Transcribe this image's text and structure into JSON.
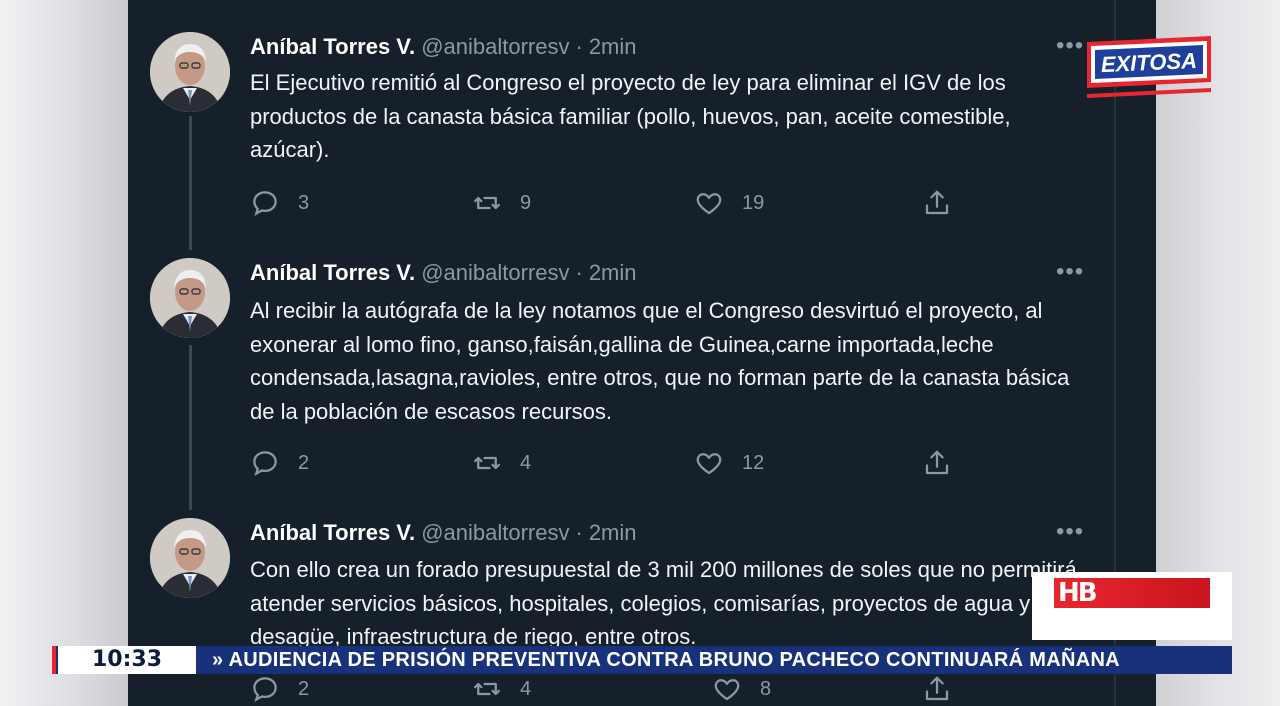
{
  "broadcast": {
    "logo_text": "EXITOSA",
    "badge_text": "HB",
    "ticker": {
      "time": "10:33",
      "headline": "» AUDIENCIA DE PRISIÓN PREVENTIVA CONTRA BRUNO PACHECO CONTINUARÁ MAÑANA"
    }
  },
  "colors": {
    "panel_bg": "#15202b",
    "muted": "#8b98a5",
    "brand_red": "#e8262f",
    "ticker_blue": "#17327a"
  },
  "tweets": [
    {
      "author": "Aníbal Torres V.",
      "handle": "@anibaltorresv",
      "separator": "·",
      "time": "2min",
      "text": "El Ejecutivo remitió al Congreso el proyecto de ley para eliminar el IGV de los productos de la canasta básica familiar (pollo, huevos, pan, aceite comestible, azúcar).",
      "replies": "3",
      "retweets": "9",
      "likes": "19"
    },
    {
      "author": "Aníbal Torres V.",
      "handle": "@anibaltorresv",
      "separator": "·",
      "time": "2min",
      "text": "Al recibir la autógrafa de la ley notamos que el Congreso desvirtuó el proyecto, al exonerar al lomo fino, ganso,faisán,gallina de Guinea,carne importada,leche condensada,lasagna,ravioles, entre otros, que no forman parte de la canasta básica de la población de escasos recursos.",
      "replies": "2",
      "retweets": "4",
      "likes": "12"
    },
    {
      "author": "Aníbal Torres V.",
      "handle": "@anibaltorresv",
      "separator": "·",
      "time": "2min",
      "text": "Con ello crea un forado presupuestal de 3 mil 200 millones de soles que no permitirá atender servicios básicos, hospitales, colegios, comisarías, proyectos de agua y desagüe, infraestructura de riego, entre otros.",
      "replies": "2",
      "retweets": "4",
      "likes": "8"
    }
  ]
}
